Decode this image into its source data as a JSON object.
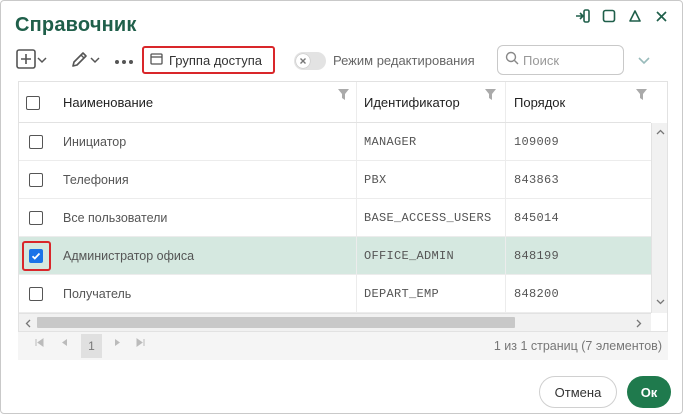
{
  "window": {
    "title": "Справочник"
  },
  "toolbar": {
    "access_group_label": "Группа доступа",
    "edit_mode_label": "Режим редактирования",
    "edit_mode_on": false,
    "search_placeholder": "Поиск",
    "search_value": ""
  },
  "table": {
    "columns": [
      {
        "label": "Наименование"
      },
      {
        "label": "Идентификатор"
      },
      {
        "label": "Порядок"
      }
    ],
    "rows": [
      {
        "name": "Инициатор",
        "identifier": "MANAGER",
        "order": "109009",
        "checked": false
      },
      {
        "name": "Телефония",
        "identifier": "PBX",
        "order": "843863",
        "checked": false
      },
      {
        "name": "Все пользователи",
        "identifier": "BASE_ACCESS_USERS",
        "order": "845014",
        "checked": false
      },
      {
        "name": "Администратор офиса",
        "identifier": "OFFICE_ADMIN",
        "order": "848199",
        "checked": true
      },
      {
        "name": "Получатель",
        "identifier": "DEPART_EMP",
        "order": "848200",
        "checked": false
      }
    ]
  },
  "pager": {
    "current_page": "1",
    "info": "1 из 1 страниц (7 элементов)"
  },
  "footer": {
    "cancel_label": "Отмена",
    "ok_label": "Ок"
  },
  "colors": {
    "title": "#1f5f4a",
    "selected_row": "#d5e8e0",
    "highlight_border": "#d9262a",
    "ok_button": "#1f7a4d",
    "checkbox_checked": "#1a73e8"
  }
}
